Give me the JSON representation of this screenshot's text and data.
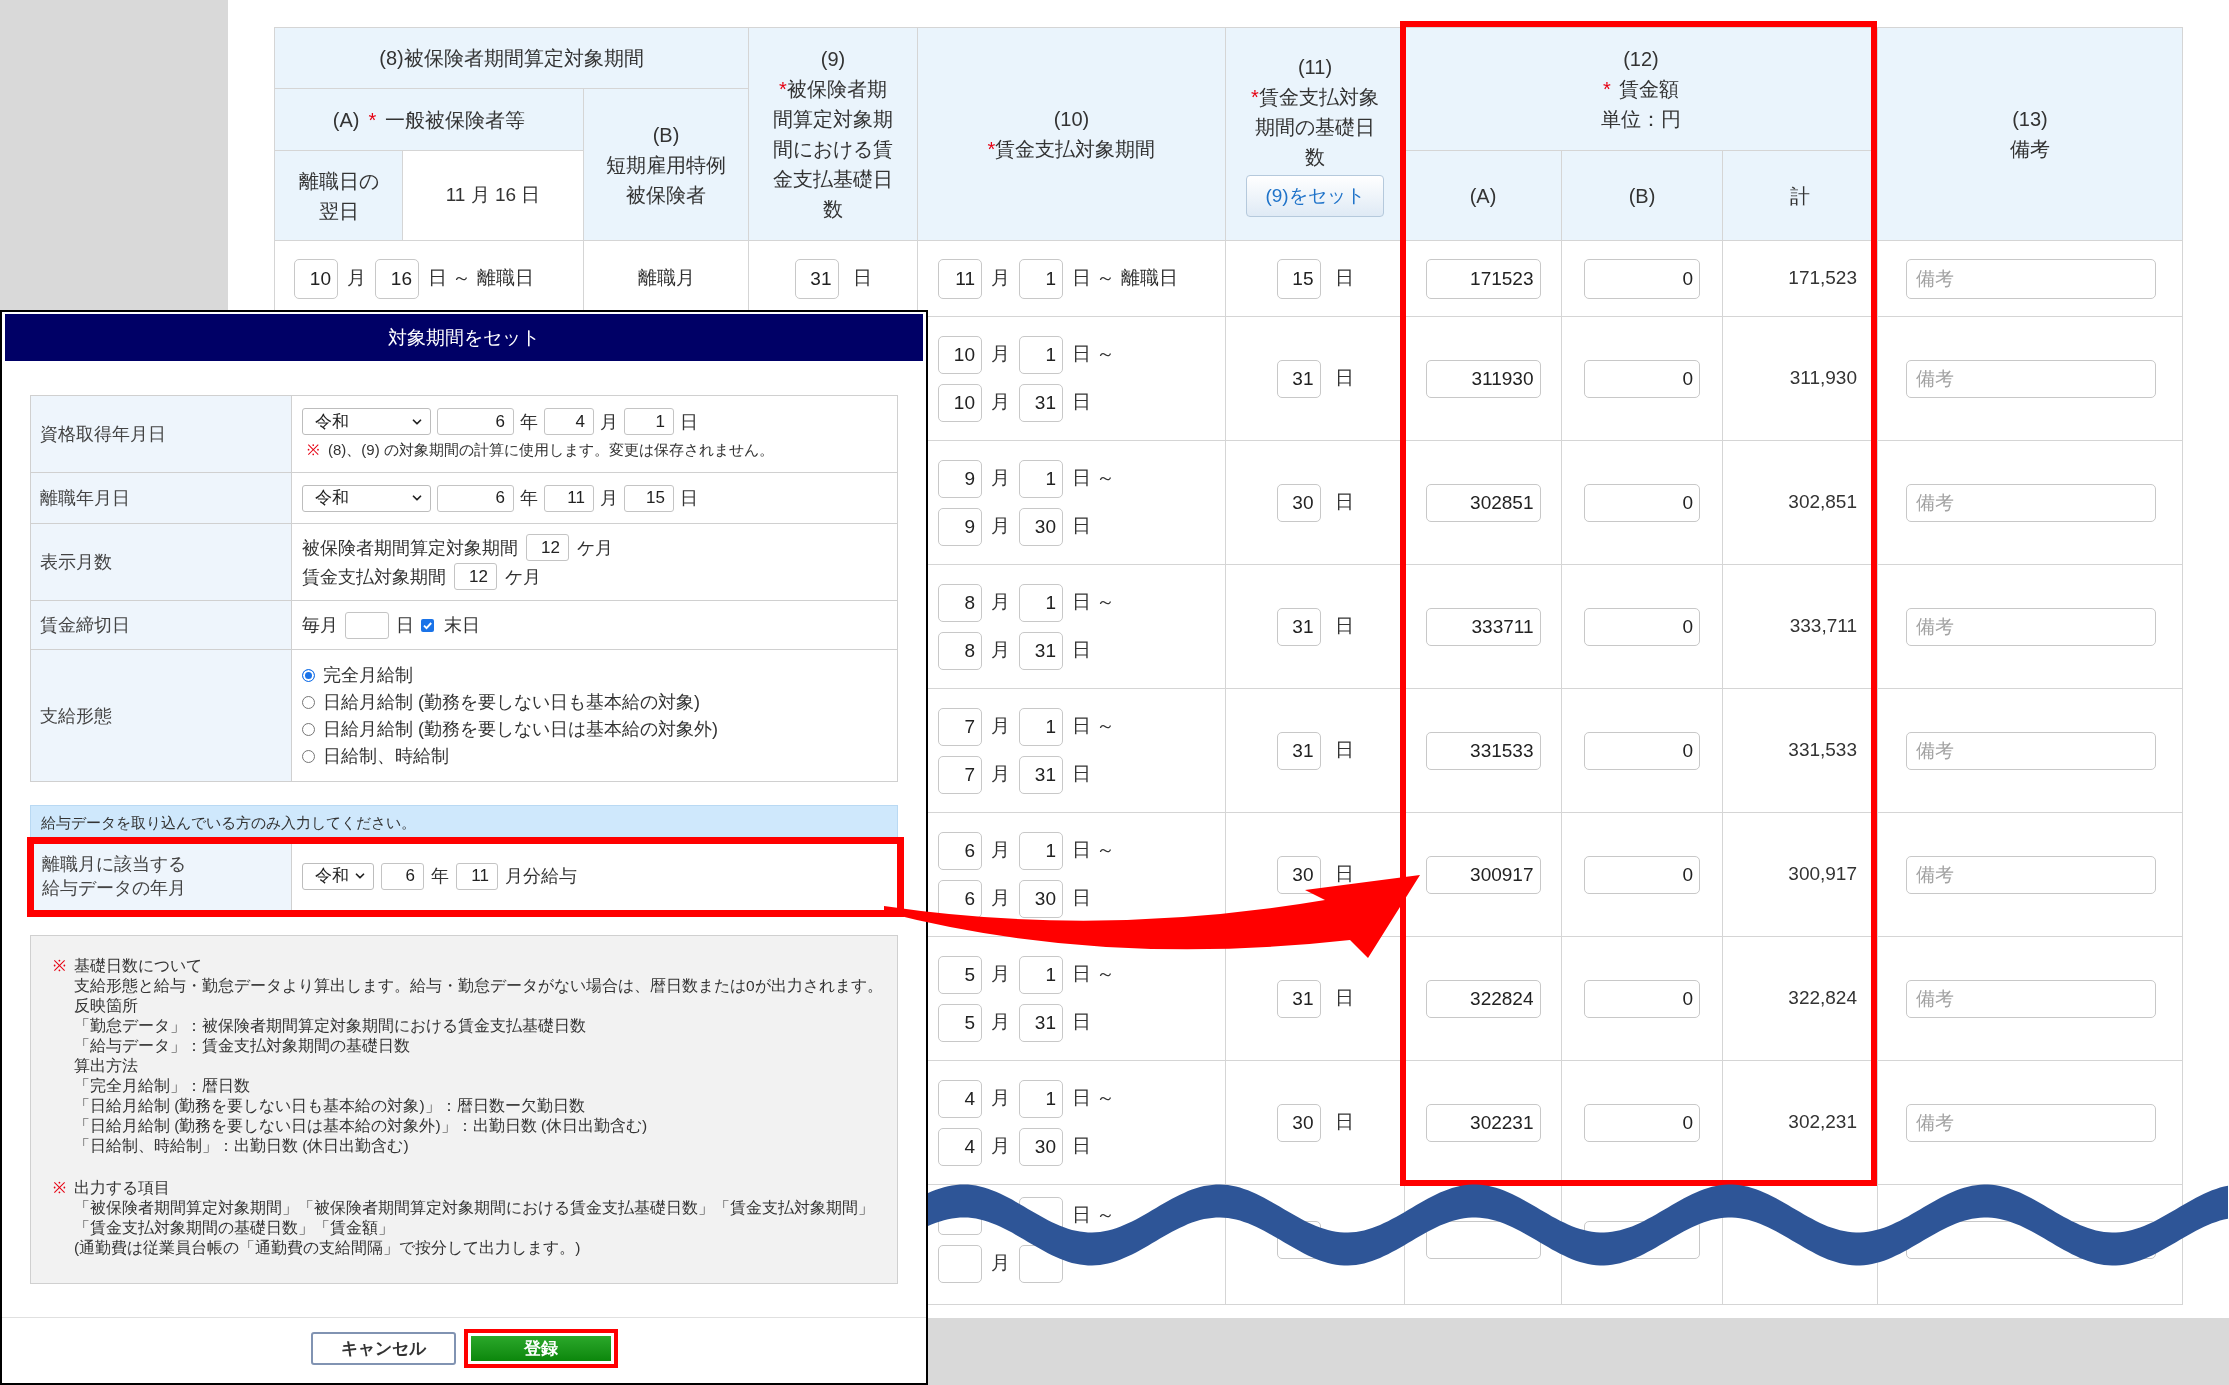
{
  "table": {
    "header": {
      "insured_period": "(8)被保険者期間算定対象期間",
      "general": {
        "number": "(A)",
        "mark": "*",
        "label": "一般被保険者等"
      },
      "day_after_label": "離職日の翌日",
      "day_after_value": "11 月 16 日",
      "short_term": {
        "number": "(B)",
        "label": "短期雇用特例被保険者"
      },
      "insured_days": {
        "number": "(9)",
        "mark": "*",
        "label": "被保険者期間算定対象期間における賃金支払基礎日数"
      },
      "wage_period": {
        "number": "(10)",
        "mark": "*",
        "label": "賃金支払対象期間"
      },
      "wage_days": {
        "number": "(11)",
        "mark": "*",
        "label": "賃金支払対象期間の基礎日数",
        "button": "(9)をセット"
      },
      "wage_amount": {
        "number": "(12)",
        "mark": "*",
        "label": "賃金額",
        "unit": "単位：円"
      },
      "wage_amount_sub": [
        "(A)",
        "(B)",
        "計"
      ],
      "remarks": {
        "number": "(13)",
        "label": "備考"
      }
    },
    "rows": [
      {
        "kind": "first",
        "service_period": {
          "month": "10",
          "month_unit": "月",
          "day": "16",
          "day_unit": "日 ～ 離職日"
        },
        "short_term": "離職月",
        "service_days": {
          "value": "31",
          "unit": "日"
        },
        "wage_period": [
          {
            "month": "11",
            "month_unit": "月",
            "day": "1",
            "day_unit": "日 ～ 離職日"
          }
        ],
        "wage_days": {
          "value": "15",
          "unit": "日"
        },
        "wage_a": "171523",
        "wage_b": "0",
        "total": "171,523",
        "remarks_placeholder": "備考"
      },
      {
        "kind": "month",
        "wage_period": [
          {
            "month": "10",
            "month_unit": "月",
            "day": "1",
            "day_unit": "日 ～"
          },
          {
            "month": "10",
            "month_unit": "月",
            "day": "31",
            "day_unit": "日"
          }
        ],
        "wage_days": {
          "value": "31",
          "unit": "日"
        },
        "wage_a": "311930",
        "wage_b": "0",
        "total": "311,930",
        "remarks_placeholder": "備考"
      },
      {
        "kind": "month",
        "wage_period": [
          {
            "month": "9",
            "month_unit": "月",
            "day": "1",
            "day_unit": "日 ～"
          },
          {
            "month": "9",
            "month_unit": "月",
            "day": "30",
            "day_unit": "日"
          }
        ],
        "wage_days": {
          "value": "30",
          "unit": "日"
        },
        "wage_a": "302851",
        "wage_b": "0",
        "total": "302,851",
        "remarks_placeholder": "備考"
      },
      {
        "kind": "month",
        "wage_period": [
          {
            "month": "8",
            "month_unit": "月",
            "day": "1",
            "day_unit": "日 ～"
          },
          {
            "month": "8",
            "month_unit": "月",
            "day": "31",
            "day_unit": "日"
          }
        ],
        "wage_days": {
          "value": "31",
          "unit": "日"
        },
        "wage_a": "333711",
        "wage_b": "0",
        "total": "333,711",
        "remarks_placeholder": "備考"
      },
      {
        "kind": "month",
        "wage_period": [
          {
            "month": "7",
            "month_unit": "月",
            "day": "1",
            "day_unit": "日 ～"
          },
          {
            "month": "7",
            "month_unit": "月",
            "day": "31",
            "day_unit": "日"
          }
        ],
        "wage_days": {
          "value": "31",
          "unit": "日"
        },
        "wage_a": "331533",
        "wage_b": "0",
        "total": "331,533",
        "remarks_placeholder": "備考"
      },
      {
        "kind": "month",
        "wage_period": [
          {
            "month": "6",
            "month_unit": "月",
            "day": "1",
            "day_unit": "日 ～"
          },
          {
            "month": "6",
            "month_unit": "月",
            "day": "30",
            "day_unit": "日"
          }
        ],
        "wage_days": {
          "value": "30",
          "unit": "日"
        },
        "wage_a": "300917",
        "wage_b": "0",
        "total": "300,917",
        "remarks_placeholder": "備考"
      },
      {
        "kind": "month",
        "wage_period": [
          {
            "month": "5",
            "month_unit": "月",
            "day": "1",
            "day_unit": "日 ～"
          },
          {
            "month": "5",
            "month_unit": "月",
            "day": "31",
            "day_unit": "日"
          }
        ],
        "wage_days": {
          "value": "31",
          "unit": "日"
        },
        "wage_a": "322824",
        "wage_b": "0",
        "total": "322,824",
        "remarks_placeholder": "備考"
      },
      {
        "kind": "month",
        "wage_period": [
          {
            "month": "4",
            "month_unit": "月",
            "day": "1",
            "day_unit": "日 ～"
          },
          {
            "month": "4",
            "month_unit": "月",
            "day": "30",
            "day_unit": "日"
          }
        ],
        "wage_days": {
          "value": "30",
          "unit": "日"
        },
        "wage_a": "302231",
        "wage_b": "0",
        "total": "302,231",
        "remarks_placeholder": "備考"
      },
      {
        "kind": "month",
        "wage_period": [
          {
            "day_unit": "日 ～"
          },
          {
            "month_unit": "月"
          }
        ]
      }
    ]
  },
  "dialog": {
    "title": "対象期間をセット",
    "fields": [
      {
        "kind": "date",
        "label": "資格取得年月日",
        "era": "令和",
        "year": "6",
        "year_unit": "年",
        "month": "4",
        "month_unit": "月",
        "day": "1",
        "day_unit": "日",
        "note_mark": "※",
        "note": "(8)、(9) の対象期間の計算に使用します。変更は保存されません。"
      },
      {
        "kind": "date",
        "label": "離職年月日",
        "era": "令和",
        "year": "6",
        "year_unit": "年",
        "month": "11",
        "month_unit": "月",
        "day": "15",
        "day_unit": "日"
      },
      {
        "kind": "months",
        "label": "表示月数",
        "lines": [
          {
            "text": "被保険者期間算定対象期間",
            "value": "12",
            "unit": "ケ月"
          },
          {
            "text": "賃金支払対象期間",
            "value": "12",
            "unit": "ケ月"
          }
        ]
      },
      {
        "kind": "closing",
        "label": "賃金締切日",
        "prefix": "毎月",
        "unit": "日",
        "checkbox": {
          "label": "末日",
          "checked": true
        }
      },
      {
        "kind": "radio",
        "label": "支給形態",
        "options": [
          {
            "label": "完全月給制",
            "selected": true
          },
          {
            "label": "日給月給制 (勤務を要しない日も基本給の対象)",
            "selected": false
          },
          {
            "label": "日給月給制 (勤務を要しない日は基本給の対象外)",
            "selected": false
          },
          {
            "label": "日給制、時給制",
            "selected": false
          }
        ]
      }
    ],
    "info": "給与データを取り込んでいる方のみ入力してください。",
    "payroll": {
      "label": "離職月に該当する給与データの年月",
      "era": "令和",
      "year": "6",
      "year_unit": "年",
      "month": "11",
      "month_unit": "月分給与"
    },
    "notes": [
      {
        "mark": "※",
        "title": "基礎日数について",
        "lines": [
          "支給形態と給与・勤怠データより算出します。給与・勤怠データがない場合は、暦日数または0が出力されます。",
          "反映箇所",
          "「勤怠データ」：被保険者期間算定対象期間における賃金支払基礎日数",
          "「給与データ」：賃金支払対象期間の基礎日数",
          "算出方法",
          "「完全月給制」：暦日数",
          "「日給月給制 (勤務を要しない日も基本給の対象)」：暦日数ー欠勤日数",
          "「日給月給制 (勤務を要しない日は基本給の対象外)」：出勤日数 (休日出勤含む)",
          "「日給制、時給制」：出勤日数 (休日出勤含む)"
        ]
      },
      {
        "mark": "※",
        "title": "出力する項目",
        "lines": [
          "「被保険者期間算定対象期間」「被保険者期間算定対象期間における賃金支払基礎日数」「賃金支払対象期間」「賃金支払対象期間の基礎日数」「賃金額」",
          "(通勤費は従業員台帳の「通勤費の支給間隔」で按分して出力します。)"
        ]
      }
    ],
    "buttons": [
      {
        "kind": "cancel",
        "label": "キャンセル"
      },
      {
        "kind": "submit",
        "label": "登録"
      }
    ]
  }
}
